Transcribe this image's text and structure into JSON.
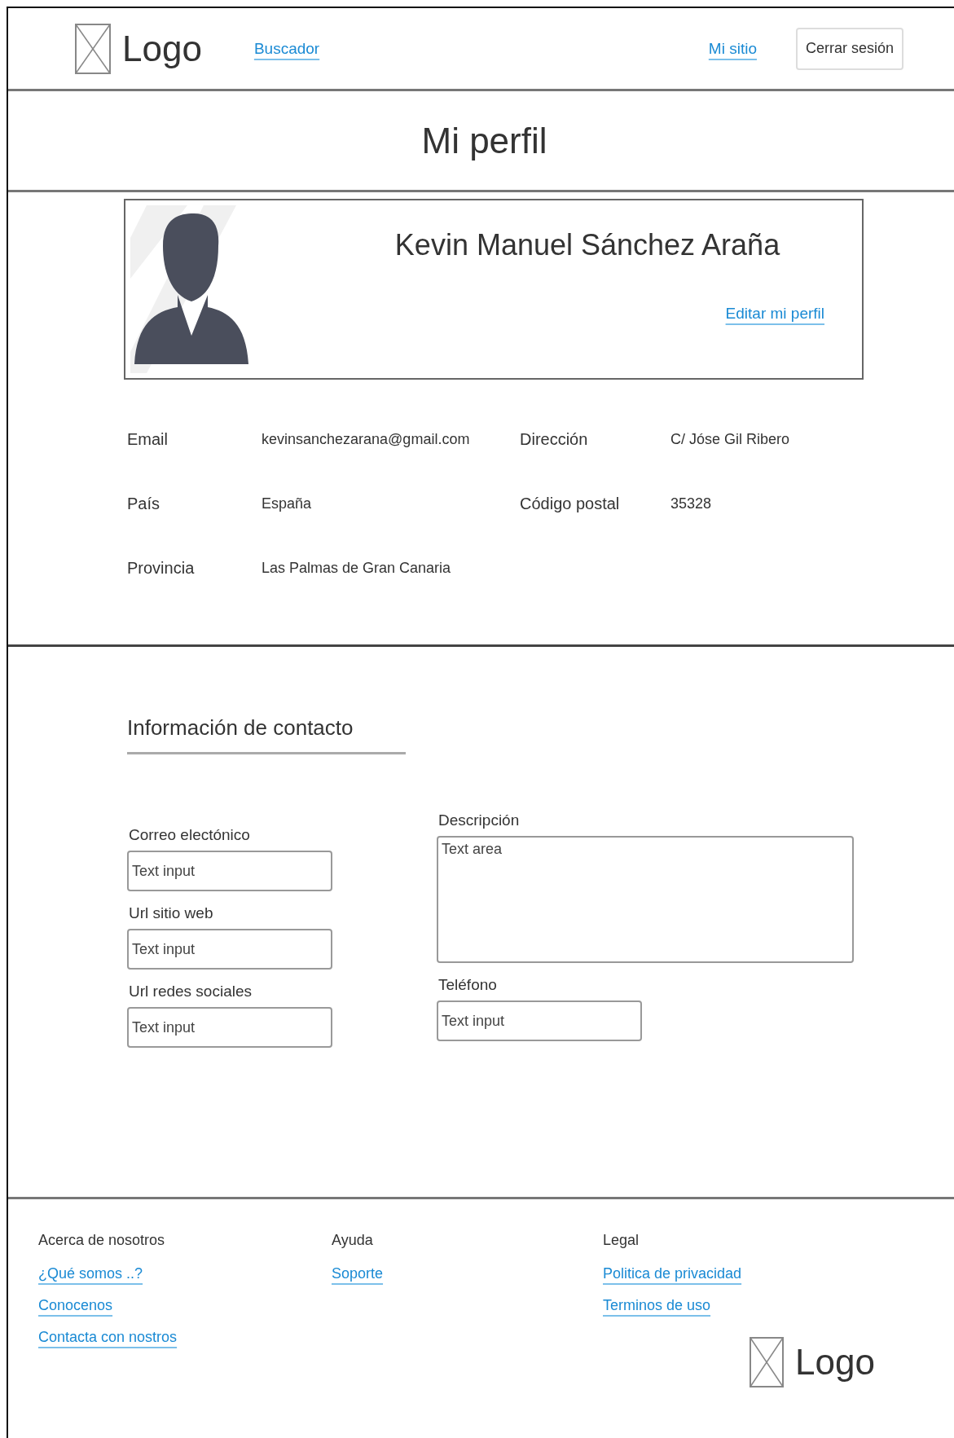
{
  "header": {
    "logo": "Logo",
    "nav_links": [
      "Buscador"
    ],
    "user_links": [
      "Mi sitio"
    ],
    "logout_button": "Cerrar sesión"
  },
  "page_title": "Mi perfil",
  "profile": {
    "name": "Kevin Manuel Sánchez Araña",
    "edit_link": "Editar mi perfil"
  },
  "details": [
    {
      "label": "Email",
      "value": "kevinsanchezarana@gmail.com"
    },
    {
      "label": "Dirección",
      "value": "C/ Jóse Gil Ribero"
    },
    {
      "label": "País",
      "value": "España"
    },
    {
      "label": "Código postal",
      "value": "35328"
    },
    {
      "label": "Provincia",
      "value": "Las Palmas de Gran Canaria"
    }
  ],
  "contact": {
    "title": "Información de contacto",
    "left_fields": [
      {
        "kind": "input",
        "label": "Correo electónico",
        "placeholder": "Text input"
      },
      {
        "kind": "input",
        "label": "Url sitio web",
        "placeholder": "Text input"
      },
      {
        "kind": "input",
        "label": "Url redes sociales",
        "placeholder": "Text input"
      }
    ],
    "right_fields": [
      {
        "kind": "textarea",
        "label": "Descripción",
        "placeholder": "Text area"
      },
      {
        "kind": "input",
        "label": "Teléfono",
        "placeholder": "Text input"
      }
    ]
  },
  "footer": {
    "columns": [
      {
        "heading": "Acerca de nosotros",
        "links": [
          "¿Qué somos ..?",
          "Conocenos",
          "Contacta con nostros"
        ]
      },
      {
        "heading": "Ayuda",
        "links": [
          "Soporte"
        ]
      },
      {
        "heading": "Legal",
        "links": [
          "Politica de privacidad",
          "Terminos de uso"
        ]
      }
    ],
    "logo": "Logo"
  }
}
